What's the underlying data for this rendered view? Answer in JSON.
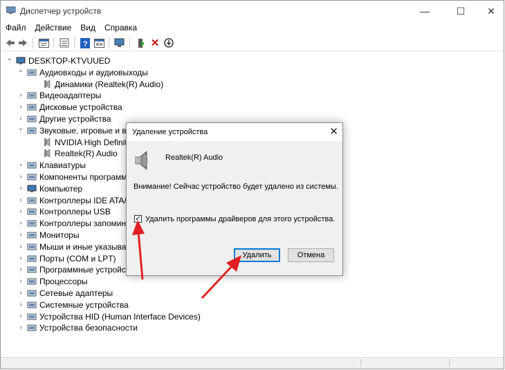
{
  "window": {
    "title": "Диспетчер устройств",
    "minimize": "—",
    "maximize": "☐",
    "close": "✕"
  },
  "menu": [
    "Файл",
    "Действие",
    "Вид",
    "Справка"
  ],
  "toolbar_icons": [
    "back-arrow-icon",
    "forward-arrow-icon",
    "properties-icon",
    "show-hidden-icon",
    "help-icon",
    "view-icon",
    "scan-hardware-icon",
    "update-driver-icon",
    "uninstall-icon",
    "disable-icon"
  ],
  "tree": {
    "root": "DESKTOP-KTVUUED",
    "nodes": [
      {
        "label": "Аудиовходы и аудиовыходы",
        "expanded": true,
        "icon": "audio-io-icon"
      },
      {
        "label": "Динамики (Realtek(R) Audio)",
        "child": true,
        "icon": "speaker-icon"
      },
      {
        "label": "Видеоадаптеры",
        "icon": "display-adapter-icon"
      },
      {
        "label": "Дисковые устройства",
        "icon": "disk-drive-icon"
      },
      {
        "label": "Другие устройства",
        "icon": "other-device-icon"
      },
      {
        "label": "Звуковые, игровые и ви",
        "expanded": true,
        "icon": "sound-icon"
      },
      {
        "label": "NVIDIA High Definitio",
        "child": true,
        "icon": "speaker-icon"
      },
      {
        "label": "Realtek(R) Audio",
        "child": true,
        "icon": "speaker-icon"
      },
      {
        "label": "Клавиатуры",
        "icon": "keyboard-icon"
      },
      {
        "label": "Компоненты программ",
        "icon": "software-component-icon"
      },
      {
        "label": "Компьютер",
        "icon": "computer-icon"
      },
      {
        "label": "Контроллеры IDE ATA/A",
        "icon": "ide-controller-icon"
      },
      {
        "label": "Контроллеры USB",
        "icon": "usb-icon"
      },
      {
        "label": "Контроллеры запомина",
        "icon": "storage-controller-icon"
      },
      {
        "label": "Мониторы",
        "icon": "monitor-icon"
      },
      {
        "label": "Мыши и иные указыва",
        "icon": "mouse-icon"
      },
      {
        "label": "Порты (COM и LPT)",
        "icon": "port-icon"
      },
      {
        "label": "Программные устройства",
        "icon": "software-device-icon"
      },
      {
        "label": "Процессоры",
        "icon": "processor-icon"
      },
      {
        "label": "Сетевые адаптеры",
        "icon": "network-adapter-icon"
      },
      {
        "label": "Системные устройства",
        "icon": "system-device-icon"
      },
      {
        "label": "Устройства HID (Human Interface Devices)",
        "icon": "hid-icon"
      },
      {
        "label": "Устройства безопасности",
        "icon": "security-device-icon"
      }
    ]
  },
  "dialog": {
    "title": "Удаление устройства",
    "close": "✕",
    "device_name": "Realtek(R) Audio",
    "warning": "Внимание! Сейчас устройство будет удалено из системы.",
    "checkbox_label": "Удалить программы драйверов для этого устройства.",
    "checkbox_checked": true,
    "checkmark": "✓",
    "delete_button": "Удалить",
    "cancel_button": "Отмена"
  },
  "colors": {
    "annotation_arrow": "#e02020",
    "primary_button_border": "#0078d7",
    "delete_icon": "#d01010",
    "help_icon": "#2060c0"
  }
}
